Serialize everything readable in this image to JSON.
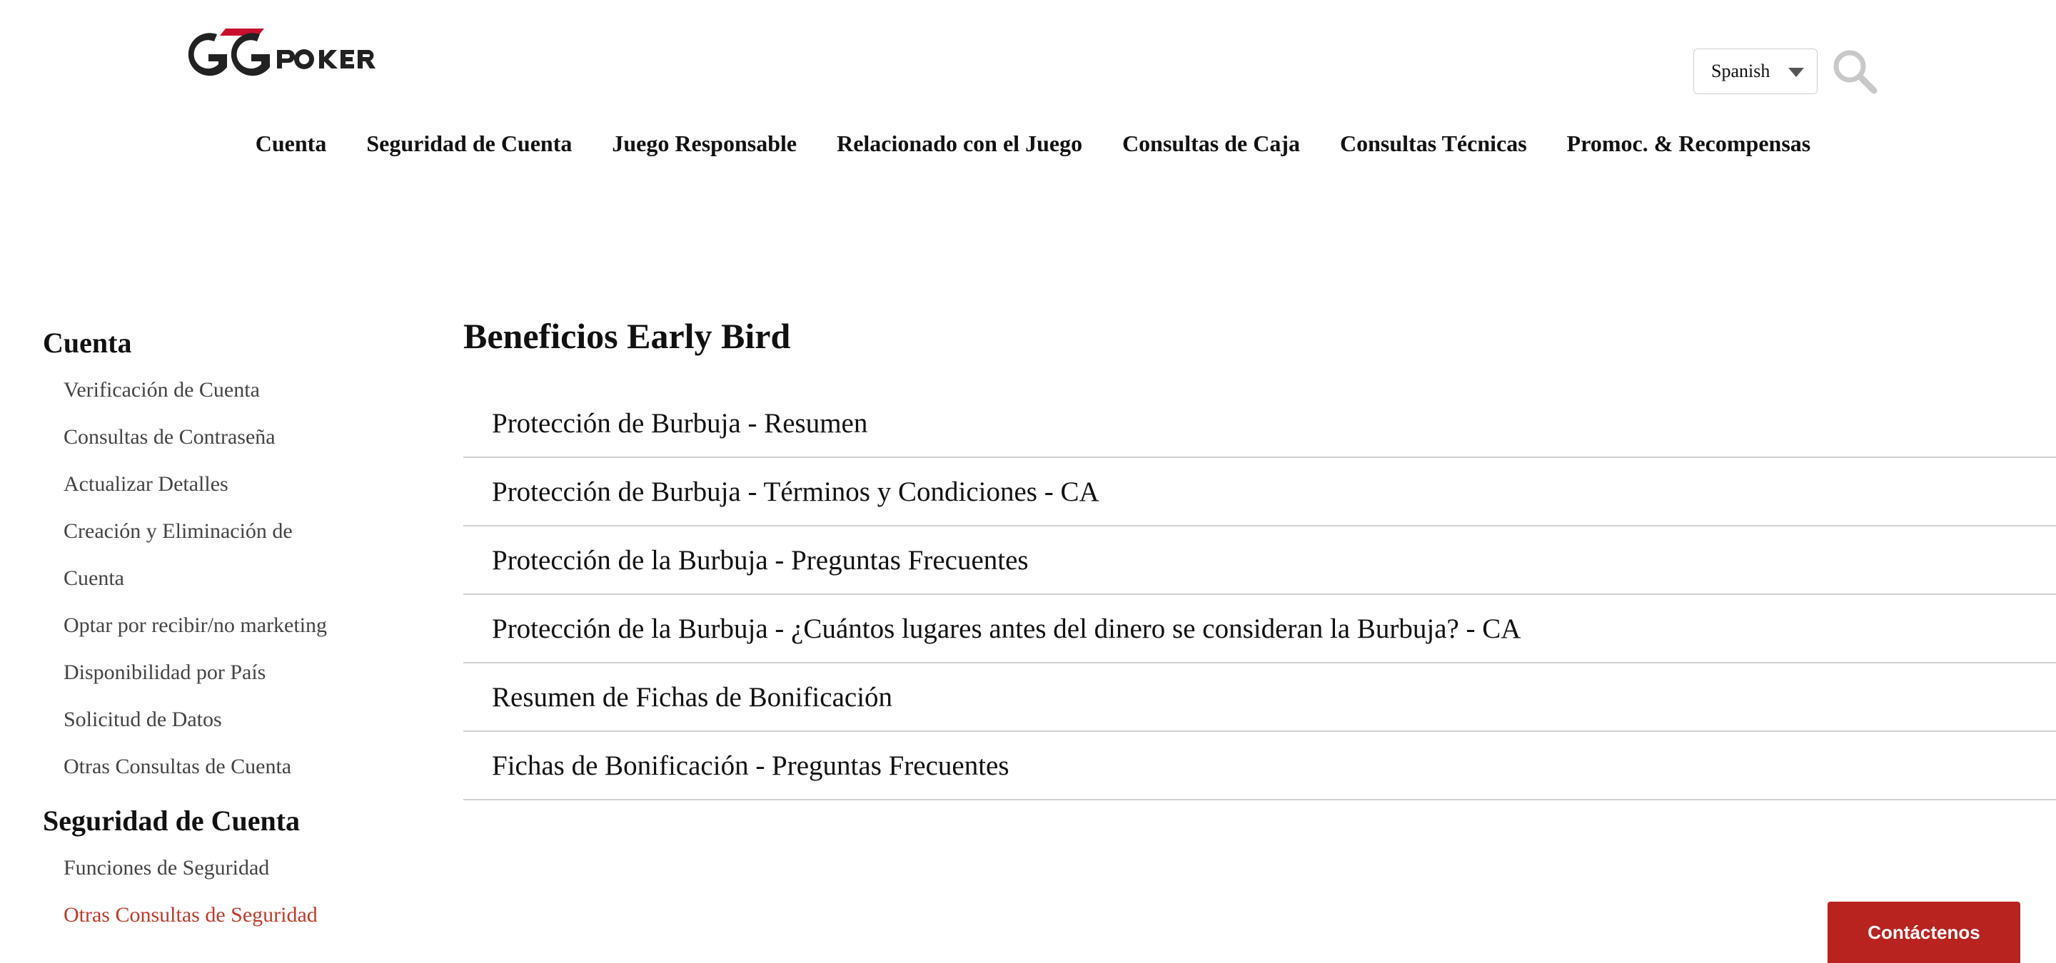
{
  "header": {
    "logo_alt": "GGPOKER",
    "language": {
      "selected": "Spanish",
      "icon": "chevron-down-icon"
    },
    "search_icon": "search-icon"
  },
  "topnav": [
    {
      "label": "Cuenta"
    },
    {
      "label": "Seguridad de Cuenta"
    },
    {
      "label": "Juego Responsable"
    },
    {
      "label": "Relacionado con el Juego"
    },
    {
      "label": "Consultas de Caja"
    },
    {
      "label": "Consultas Técnicas"
    },
    {
      "label": "Promoc. & Recompensas"
    }
  ],
  "sidebar": {
    "sections": [
      {
        "title": "Cuenta",
        "items": [
          {
            "label": "Verificación de Cuenta"
          },
          {
            "label": "Consultas de Contraseña"
          },
          {
            "label": "Actualizar Detalles"
          },
          {
            "label": "Creación y Eliminación de"
          },
          {
            "label": "Cuenta"
          },
          {
            "label": "Optar por recibir/no marketing"
          },
          {
            "label": "Disponibilidad por País"
          },
          {
            "label": "Solicitud de Datos"
          },
          {
            "label": "Otras Consultas de Cuenta"
          }
        ]
      },
      {
        "title": "Seguridad de Cuenta",
        "items": [
          {
            "label": "Funciones de Seguridad"
          },
          {
            "label": "Otras Consultas de Seguridad",
            "active": true
          }
        ]
      }
    ]
  },
  "main": {
    "title": "Beneficios Early Bird",
    "articles": [
      {
        "label": "Protección de Burbuja - Resumen"
      },
      {
        "label": "Protección de Burbuja - Términos y Condiciones - CA"
      },
      {
        "label": "Protección de la Burbuja - Preguntas Frecuentes"
      },
      {
        "label": "Protección de la Burbuja - ¿Cuántos lugares antes del dinero se consideran la Burbuja? - CA"
      },
      {
        "label": "Resumen de Fichas de Bonificación"
      },
      {
        "label": "Fichas de Bonificación - Preguntas Frecuentes"
      }
    ]
  },
  "contact_button": {
    "label": "Contáctenos"
  },
  "colors": {
    "accent_red": "#b8231f",
    "active_link": "#c0392b",
    "divider": "#cfcfcf"
  }
}
